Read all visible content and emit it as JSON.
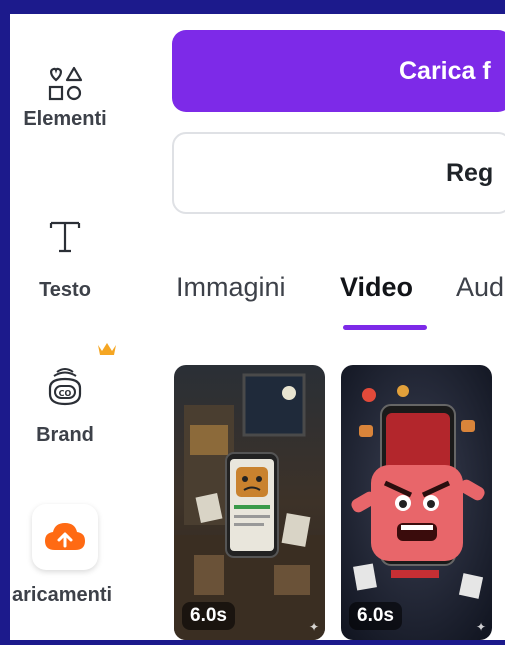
{
  "sidebar": {
    "items": [
      {
        "label": "Elementi",
        "icon": "shapes-icon"
      },
      {
        "label": "Testo",
        "icon": "text-icon"
      },
      {
        "label": "Brand",
        "icon": "brand-kit-icon",
        "badge": "crown-icon"
      },
      {
        "label": "aricamenti",
        "icon": "cloud-upload-icon"
      }
    ]
  },
  "main": {
    "upload_button": "Carica f",
    "record_button": "Reg",
    "tabs": [
      {
        "label": "Immagini",
        "active": false
      },
      {
        "label": "Video",
        "active": true
      },
      {
        "label": "Aud",
        "active": false
      }
    ],
    "thumbnails": [
      {
        "duration": "6.0s"
      },
      {
        "duration": "6.0s"
      }
    ]
  },
  "colors": {
    "accent": "#7d2ae8",
    "upload_orange": "#ff6a13",
    "crown": "#f5a623",
    "frame_border": "#1c1a8c"
  }
}
